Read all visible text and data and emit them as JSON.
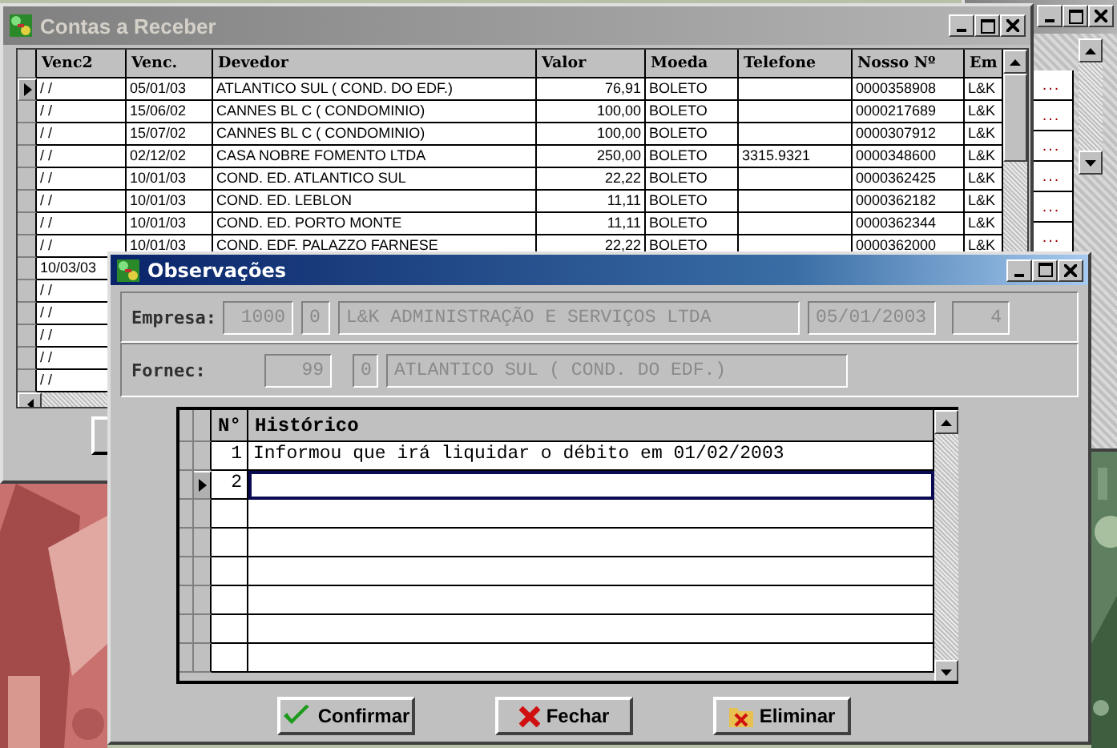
{
  "back_window": {
    "row_buttons": [
      "...",
      "...",
      "...",
      "...",
      "...",
      "..."
    ]
  },
  "contas_window": {
    "title": "Contas a Receber",
    "columns": [
      "Venc2",
      "Venc.",
      "Devedor",
      "Valor",
      "Moeda",
      "Telefone",
      "Nosso Nº",
      "Em"
    ],
    "rows": [
      {
        "selected": true,
        "venc2": "/ /",
        "venc": "05/01/03",
        "devedor": "ATLANTICO SUL ( COND. DO EDF.)",
        "valor": "76,91",
        "moeda": "BOLETO",
        "nosso": "0000358908",
        "em": "L&K"
      },
      {
        "selected": false,
        "venc2": "/ /",
        "venc": "15/06/02",
        "devedor": "CANNES BL C ( CONDOMINIO)",
        "valor": "100,00",
        "moeda": "BOLETO",
        "nosso": "0000217689",
        "em": "L&K"
      },
      {
        "selected": false,
        "venc2": "/ /",
        "venc": "15/07/02",
        "devedor": "CANNES BL C ( CONDOMINIO)",
        "valor": "100,00",
        "moeda": "BOLETO",
        "nosso": "0000307912",
        "em": "L&K"
      },
      {
        "selected": false,
        "venc2": "/ /",
        "venc": "02/12/02",
        "devedor": "CASA NOBRE FOMENTO LTDA",
        "valor": "250,00",
        "moeda": "BOLETO",
        "telefone": "3315.9321",
        "nosso": "0000348600",
        "em": "L&K"
      },
      {
        "selected": false,
        "venc2": "/ /",
        "venc": "10/01/03",
        "devedor": "COND. ED. ATLANTICO SUL",
        "valor": "22,22",
        "moeda": "BOLETO",
        "nosso": "0000362425",
        "em": "L&K"
      },
      {
        "selected": false,
        "venc2": "/ /",
        "venc": "10/01/03",
        "devedor": "COND. ED. LEBLON",
        "valor": "11,11",
        "moeda": "BOLETO",
        "nosso": "0000362182",
        "em": "L&K"
      },
      {
        "selected": false,
        "venc2": "/ /",
        "venc": "10/01/03",
        "devedor": "COND. ED. PORTO MONTE",
        "valor": "11,11",
        "moeda": "BOLETO",
        "nosso": "0000362344",
        "em": "L&K"
      },
      {
        "selected": false,
        "venc2": "/ /",
        "venc": "10/01/03",
        "devedor": "COND. EDF. PALAZZO FARNESE",
        "valor": "22,22",
        "moeda": "BOLETO",
        "nosso": "0000362000",
        "em": "L&K"
      },
      {
        "selected": false,
        "venc2": "10/03/03"
      },
      {
        "selected": false,
        "venc2": "/ /"
      },
      {
        "selected": false,
        "venc2": "/ /"
      },
      {
        "selected": false,
        "venc2": "/ /"
      },
      {
        "selected": false,
        "venc2": "/ /"
      },
      {
        "selected": false,
        "venc2": "/ /"
      }
    ]
  },
  "observacoes_dialog": {
    "title": "Observações",
    "empresa": {
      "label": "Empresa:",
      "code": "1000",
      "digit": "0",
      "name": "L&K ADMINISTRAÇÃO E SERVIÇOS LTDA",
      "date": "05/01/2003",
      "number": "4"
    },
    "fornec": {
      "label": "Fornec:",
      "code": "99",
      "digit": "0",
      "name": "ATLANTICO SUL ( COND. DO EDF.)"
    },
    "history": {
      "columns": [
        "N°",
        "Histórico"
      ],
      "rows": [
        {
          "number": "1",
          "text": "Informou que irá liquidar o débito em 01/02/2003",
          "selected": false
        },
        {
          "number": "2",
          "selected": true
        }
      ]
    },
    "buttons": [
      {
        "label": "Confirmar",
        "kind": "confirm"
      },
      {
        "label": "Fechar",
        "kind": "close"
      },
      {
        "label": "Eliminar",
        "kind": "delete"
      }
    ]
  }
}
